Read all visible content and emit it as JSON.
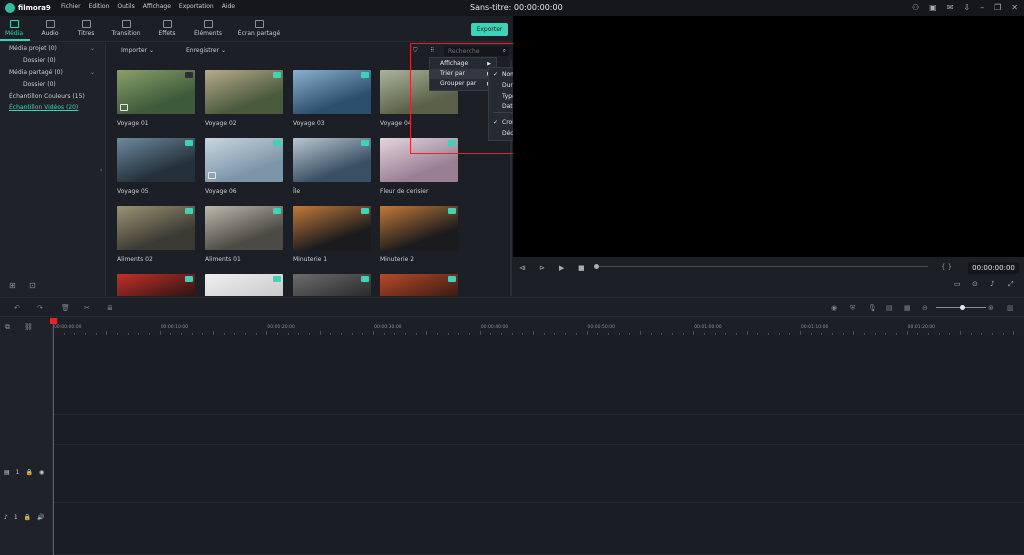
{
  "app": {
    "logo_text": "filmora9",
    "doc_title": "Sans-titre:  00:00:00:00",
    "menu": [
      "Fichier",
      "Edition",
      "Outils",
      "Affichage",
      "Exportation",
      "Aide"
    ]
  },
  "tabs": [
    {
      "label": "Média",
      "active": true
    },
    {
      "label": "Audio"
    },
    {
      "label": "Titres"
    },
    {
      "label": "Transition"
    },
    {
      "label": "Effets"
    },
    {
      "label": "Éléments"
    },
    {
      "label": "Écran partagé"
    }
  ],
  "export_label": "Exporter",
  "tree": {
    "items": [
      {
        "label": "Média projet (0)"
      },
      {
        "label": "Dossier (0)"
      },
      {
        "label": "Média partagé (0)"
      },
      {
        "label": "Dossier (0)"
      },
      {
        "label": "Échantillon Couleurs (15)"
      },
      {
        "label": "Échantillon Vidéos (20)",
        "active": true
      }
    ]
  },
  "library": {
    "import_label": "Importer",
    "record_label": "Enregistrer",
    "search_placeholder": "Recherche"
  },
  "media": [
    {
      "label": "Voyage 01",
      "colors": [
        "#3d5a3a",
        "#8aa06a"
      ]
    },
    {
      "label": "Voyage 02",
      "colors": [
        "#4a5a3c",
        "#b7a98a"
      ]
    },
    {
      "label": "Voyage 03",
      "colors": [
        "#2d4f6e",
        "#8bb0cf"
      ]
    },
    {
      "label": "Voyage 04",
      "colors": [
        "#5a6148",
        "#aab49a"
      ]
    },
    {
      "label": "Voyage 05",
      "colors": [
        "#25313a",
        "#6c8aa0"
      ]
    },
    {
      "label": "Voyage 06",
      "colors": [
        "#7d95a8",
        "#c9d6df"
      ]
    },
    {
      "label": "Île",
      "colors": [
        "#394f63",
        "#b9c7d1"
      ]
    },
    {
      "label": "Fleur de cerisier",
      "colors": [
        "#9a7f94",
        "#e4d4dc"
      ]
    },
    {
      "label": "Aliments 02",
      "colors": [
        "#3b3a33",
        "#9c9274"
      ]
    },
    {
      "label": "Aliments 01",
      "colors": [
        "#4c4a44",
        "#bdb8ad"
      ]
    },
    {
      "label": "Minuterie 1",
      "colors": [
        "#1b1b1d",
        "#c27a3a"
      ]
    },
    {
      "label": "Minuterie 2",
      "colors": [
        "#1b1b1d",
        "#c27a3a"
      ]
    },
    {
      "label": "",
      "colors": [
        "#2a1414",
        "#c3302a"
      ]
    },
    {
      "label": "",
      "colors": [
        "#c9c9c9",
        "#efefef"
      ]
    },
    {
      "label": "",
      "colors": [
        "#2a2a2a",
        "#6c6c6c"
      ]
    },
    {
      "label": "",
      "colors": [
        "#3a1b12",
        "#b64a2a"
      ]
    }
  ],
  "context_menu": {
    "items": [
      "Affichage",
      "Trier par",
      "Grouper par"
    ],
    "sort_options": [
      "Nom",
      "Durée",
      "Type",
      "Date de création"
    ],
    "order_options": [
      "Croissant",
      "Décroissant"
    ],
    "checked_sort": "Nom",
    "checked_order": "Croissant"
  },
  "player": {
    "time": "00:00:00:00",
    "brackets": "{  }"
  },
  "timeline": {
    "ruler": [
      "00:00:00:00",
      "00:00:10:00",
      "00:00:20:00",
      "00:00:30:00",
      "00:00:40:00",
      "00:00:50:00",
      "00:01:00:00",
      "00:01:10:00",
      "00:01:20:00"
    ],
    "video_track": "1",
    "audio_track": "1"
  }
}
